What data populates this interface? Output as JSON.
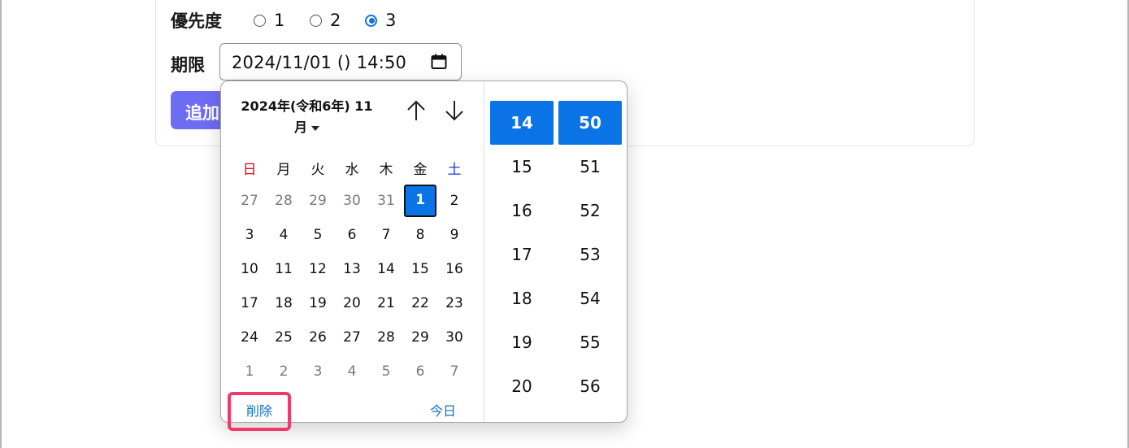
{
  "form": {
    "priority_label": "優先度",
    "priority_options": [
      "1",
      "2",
      "3"
    ],
    "priority_selected": "3",
    "deadline_label": "期限",
    "deadline_value": "2024/11/01 () 14:50",
    "add_button_label": "追加"
  },
  "picker": {
    "month_title_line1": "2024年(令和6年) 11",
    "month_title_line2": "月",
    "weekdays": [
      "日",
      "月",
      "火",
      "水",
      "木",
      "金",
      "土"
    ],
    "days": [
      [
        "27",
        "28",
        "29",
        "30",
        "31",
        "1",
        "2"
      ],
      [
        "3",
        "4",
        "5",
        "6",
        "7",
        "8",
        "9"
      ],
      [
        "10",
        "11",
        "12",
        "13",
        "14",
        "15",
        "16"
      ],
      [
        "17",
        "18",
        "19",
        "20",
        "21",
        "22",
        "23"
      ],
      [
        "24",
        "25",
        "26",
        "27",
        "28",
        "29",
        "30"
      ],
      [
        "1",
        "2",
        "3",
        "4",
        "5",
        "6",
        "7"
      ]
    ],
    "selected_day": "1",
    "clear_label": "削除",
    "today_label": "今日",
    "hours": [
      "14",
      "15",
      "16",
      "17",
      "18",
      "19",
      "20"
    ],
    "minutes": [
      "50",
      "51",
      "52",
      "53",
      "54",
      "55",
      "56"
    ],
    "selected_hour": "14",
    "selected_minute": "50"
  },
  "colors": {
    "accent": "#0a73e6",
    "add_button": "#6e6cf2",
    "highlight_box": "#ee3b6b",
    "link": "#1270c4",
    "sunday": "#e0001b",
    "saturday": "#1a3ccc"
  },
  "icons": {
    "calendar": "calendar-icon",
    "prev_month": "arrow-up-icon",
    "next_month": "arrow-down-icon",
    "dropdown": "caret-down-icon"
  }
}
